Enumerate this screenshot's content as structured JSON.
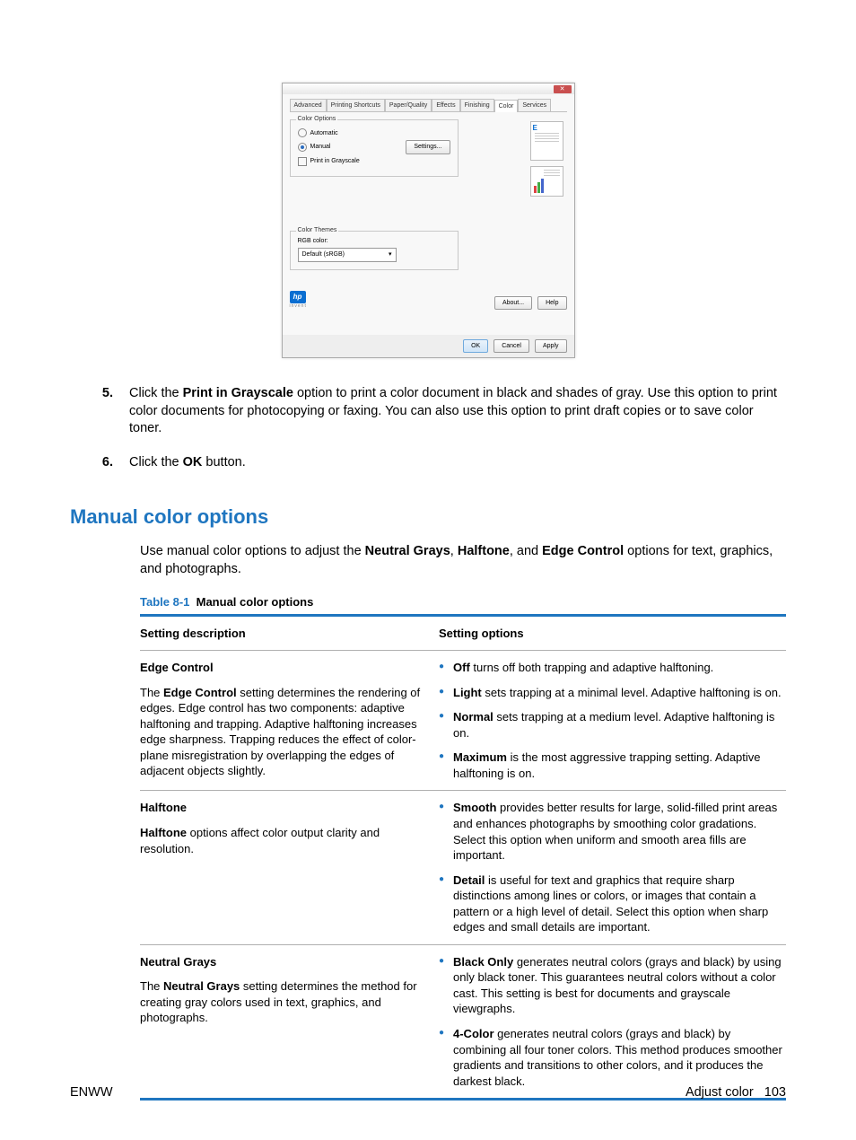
{
  "dialog": {
    "tabs": [
      "Advanced",
      "Printing Shortcuts",
      "Paper/Quality",
      "Effects",
      "Finishing",
      "Color",
      "Services"
    ],
    "active_tab": "Color",
    "group_color_options": "Color Options",
    "radio_auto": "Automatic",
    "radio_manual": "Manual",
    "btn_settings": "Settings...",
    "check_grayscale": "Print in Grayscale",
    "group_color_themes": "Color Themes",
    "rgb_label": "RGB color:",
    "rgb_value": "Default (sRGB)",
    "btn_about": "About...",
    "btn_help": "Help",
    "btn_ok": "OK",
    "btn_cancel": "Cancel",
    "btn_apply": "Apply",
    "badge": "hp"
  },
  "steps": [
    {
      "num": "5.",
      "pre": "Click the ",
      "bold1": "Print in Grayscale",
      "post": " option to print a color document in black and shades of gray. Use this option to print color documents for photocopying or faxing. You can also use this option to print draft copies or to save color toner."
    },
    {
      "num": "6.",
      "pre": "Click the ",
      "bold1": "OK",
      "post": " button."
    }
  ],
  "section_heading": "Manual color options",
  "intro": {
    "a": "Use manual color options to adjust the ",
    "b1": "Neutral Grays",
    "c": ", ",
    "b2": "Halftone",
    "d": ", and ",
    "b3": "Edge Control",
    "e": " options for text, graphics, and photographs."
  },
  "table_caption_prefix": "Table 8-1",
  "table_caption_title": "Manual color options",
  "table_header_desc": "Setting description",
  "table_header_opt": "Setting options",
  "rows": [
    {
      "title": "Edge Control",
      "desc_pre": "The ",
      "desc_bold": "Edge Control",
      "desc_post": " setting determines the rendering of edges. Edge control has two components: adaptive halftoning and trapping. Adaptive halftoning increases edge sharpness. Trapping reduces the effect of color-plane misregistration by overlapping the edges of adjacent objects slightly.",
      "opts": [
        {
          "b": "Off",
          "t": " turns off both trapping and adaptive halftoning."
        },
        {
          "b": "Light",
          "t": " sets trapping at a minimal level. Adaptive halftoning is on."
        },
        {
          "b": "Normal",
          "t": " sets trapping at a medium level. Adaptive halftoning is on."
        },
        {
          "b": "Maximum",
          "t": " is the most aggressive trapping setting. Adaptive halftoning is on."
        }
      ]
    },
    {
      "title": "Halftone",
      "desc_pre": "",
      "desc_bold": "Halftone",
      "desc_post": " options affect color output clarity and resolution.",
      "opts": [
        {
          "b": "Smooth",
          "t": " provides better results for large, solid-filled print areas and enhances photographs by smoothing color gradations. Select this option when uniform and smooth area fills are important."
        },
        {
          "b": "Detail",
          "t": " is useful for text and graphics that require sharp distinctions among lines or colors, or images that contain a pattern or a high level of detail. Select this option when sharp edges and small details are important."
        }
      ]
    },
    {
      "title": "Neutral Grays",
      "desc_pre": "The ",
      "desc_bold": "Neutral Grays",
      "desc_post": " setting determines the method for creating gray colors used in text, graphics, and photographs.",
      "opts": [
        {
          "b": "Black Only",
          "t": " generates neutral colors (grays and black) by using only black toner. This guarantees neutral colors without a color cast. This setting is best for documents and grayscale viewgraphs."
        },
        {
          "b": "4-Color",
          "t": " generates neutral colors (grays and black) by combining all four toner colors. This method produces smoother gradients and transitions to other colors, and it produces the darkest black."
        }
      ]
    }
  ],
  "footer_left": "ENWW",
  "footer_right_label": "Adjust color",
  "footer_page": "103"
}
